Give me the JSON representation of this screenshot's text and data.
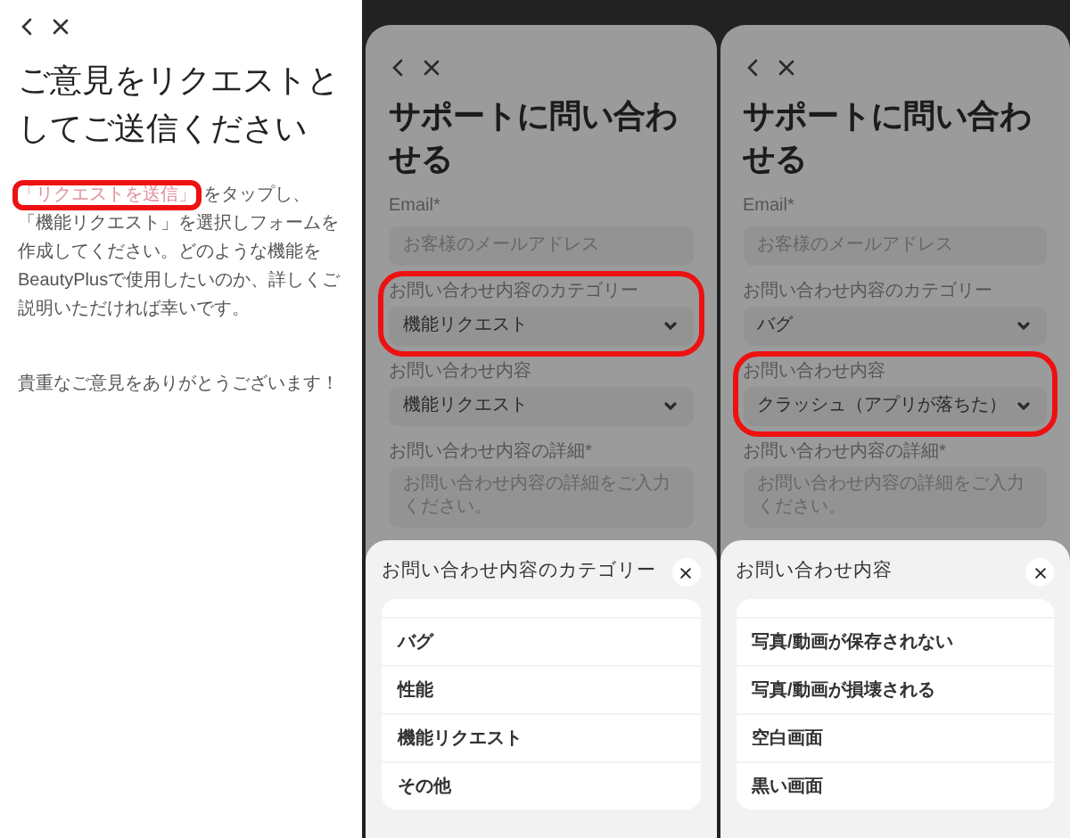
{
  "panels": [
    {
      "kind": "info",
      "title": "ご意見をリクエストとしてご送信ください",
      "intro": {
        "link": "「リクエストを送信」",
        "link_highlighted": true,
        "text": "をタップし、「機能リクエスト」を選択しフォームを作成してください。どのような機能をBeautyPlusで使用したいのか、詳しくご説明いただければ幸いです。"
      },
      "thanks": "貴重なご意見をありがとうございます！"
    },
    {
      "kind": "form",
      "title": "サポートに問い合わせる",
      "fields": [
        {
          "kind": "input",
          "label": "Email*",
          "placeholder": "お客様のメールアドレス",
          "highlighted": false
        },
        {
          "kind": "select",
          "label": "お問い合わせ内容のカテゴリー",
          "value": "機能リクエスト",
          "highlighted": true
        },
        {
          "kind": "select",
          "label": "お問い合わせ内容",
          "value": "機能リクエスト",
          "highlighted": false
        },
        {
          "kind": "textarea",
          "label": "お問い合わせ内容の詳細*",
          "placeholder": "お問い合わせ内容の詳細をご入力ください。",
          "highlighted": false
        }
      ],
      "sheet": {
        "title": "お問い合わせ内容のカテゴリー",
        "items": [
          "バグ",
          "性能",
          "機能リクエスト",
          "その他"
        ]
      }
    },
    {
      "kind": "form",
      "title": "サポートに問い合わせる",
      "fields": [
        {
          "kind": "input",
          "label": "Email*",
          "placeholder": "お客様のメールアドレス",
          "highlighted": false
        },
        {
          "kind": "select",
          "label": "お問い合わせ内容のカテゴリー",
          "value": "バグ",
          "highlighted": false
        },
        {
          "kind": "select",
          "label": "お問い合わせ内容",
          "value": "クラッシュ（アプリが落ちた）",
          "highlighted": true
        },
        {
          "kind": "textarea",
          "label": "お問い合わせ内容の詳細*",
          "placeholder": "お問い合わせ内容の詳細をご入力ください。",
          "highlighted": false
        }
      ],
      "sheet": {
        "title": "お問い合わせ内容",
        "items": [
          "写真/動画が保存されない",
          "写真/動画が損壊される",
          "空白画面",
          "黒い画面"
        ]
      }
    }
  ]
}
